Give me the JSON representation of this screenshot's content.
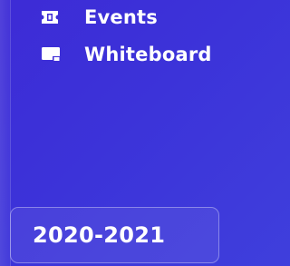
{
  "sidebar": {
    "items": [
      {
        "label": "Events",
        "icon": "ticket-icon"
      },
      {
        "label": "Whiteboard",
        "icon": "whiteboard-icon"
      }
    ],
    "year_selector": {
      "label": "2020-2021"
    }
  },
  "colors": {
    "background": "#3d2bd6",
    "text": "#ffffff"
  }
}
